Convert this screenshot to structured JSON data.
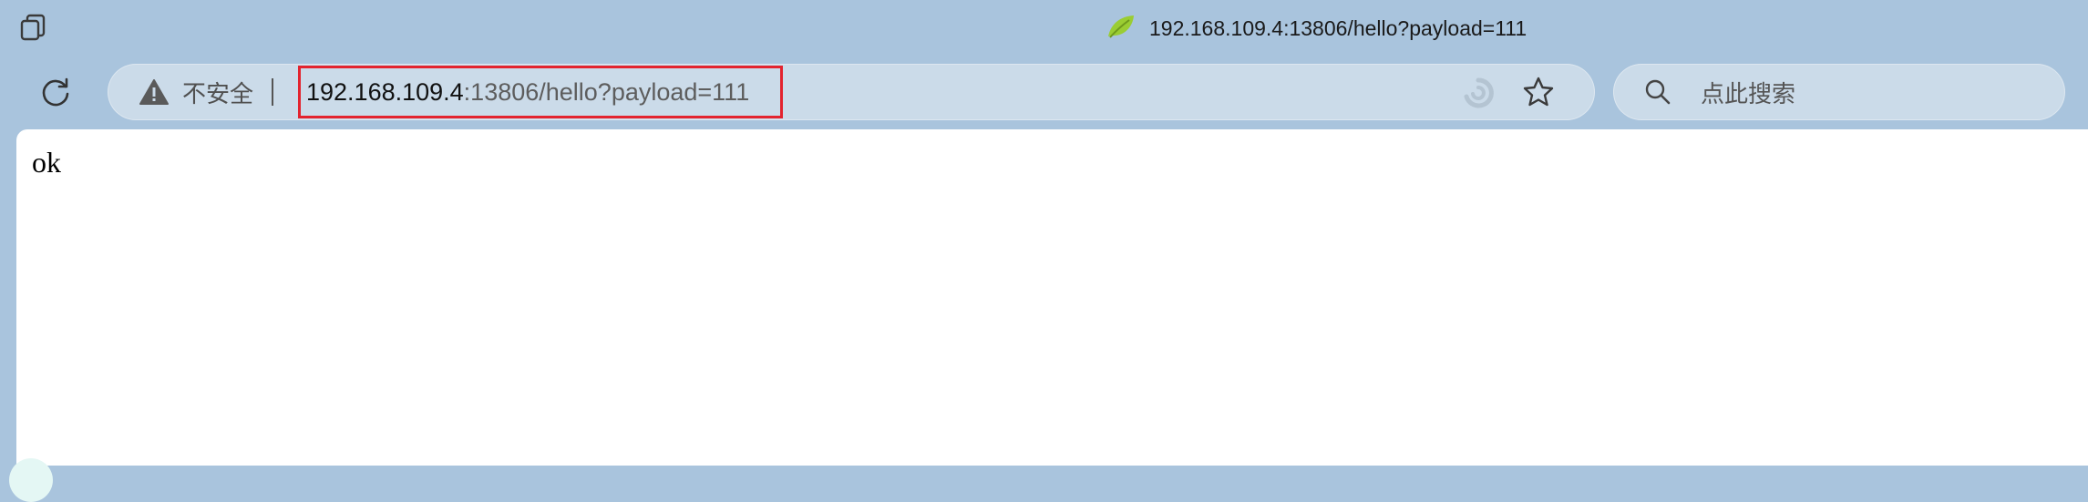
{
  "window": {
    "tab_title": "192.168.109.4:13806/hello?payload=111"
  },
  "toolbar": {
    "security_label": "不安全",
    "url_host": "192.168.109.4",
    "url_rest": ":13806/hello?payload=111",
    "search_placeholder": "点此搜索"
  },
  "page": {
    "body_text": "ok"
  },
  "icons": {
    "tab_actions": "tab-actions-icon",
    "site_favicon": "leaf-favicon-icon",
    "refresh": "refresh-icon",
    "warning": "warning-triangle-icon",
    "read_aloud": "read-aloud-icon",
    "favorite": "star-icon",
    "search": "search-icon"
  },
  "colors": {
    "chrome_background": "#a9c4dd",
    "address_bar": "#cbdbe9",
    "highlight_border": "#e3232e",
    "favicon_green": "#9acd32"
  }
}
